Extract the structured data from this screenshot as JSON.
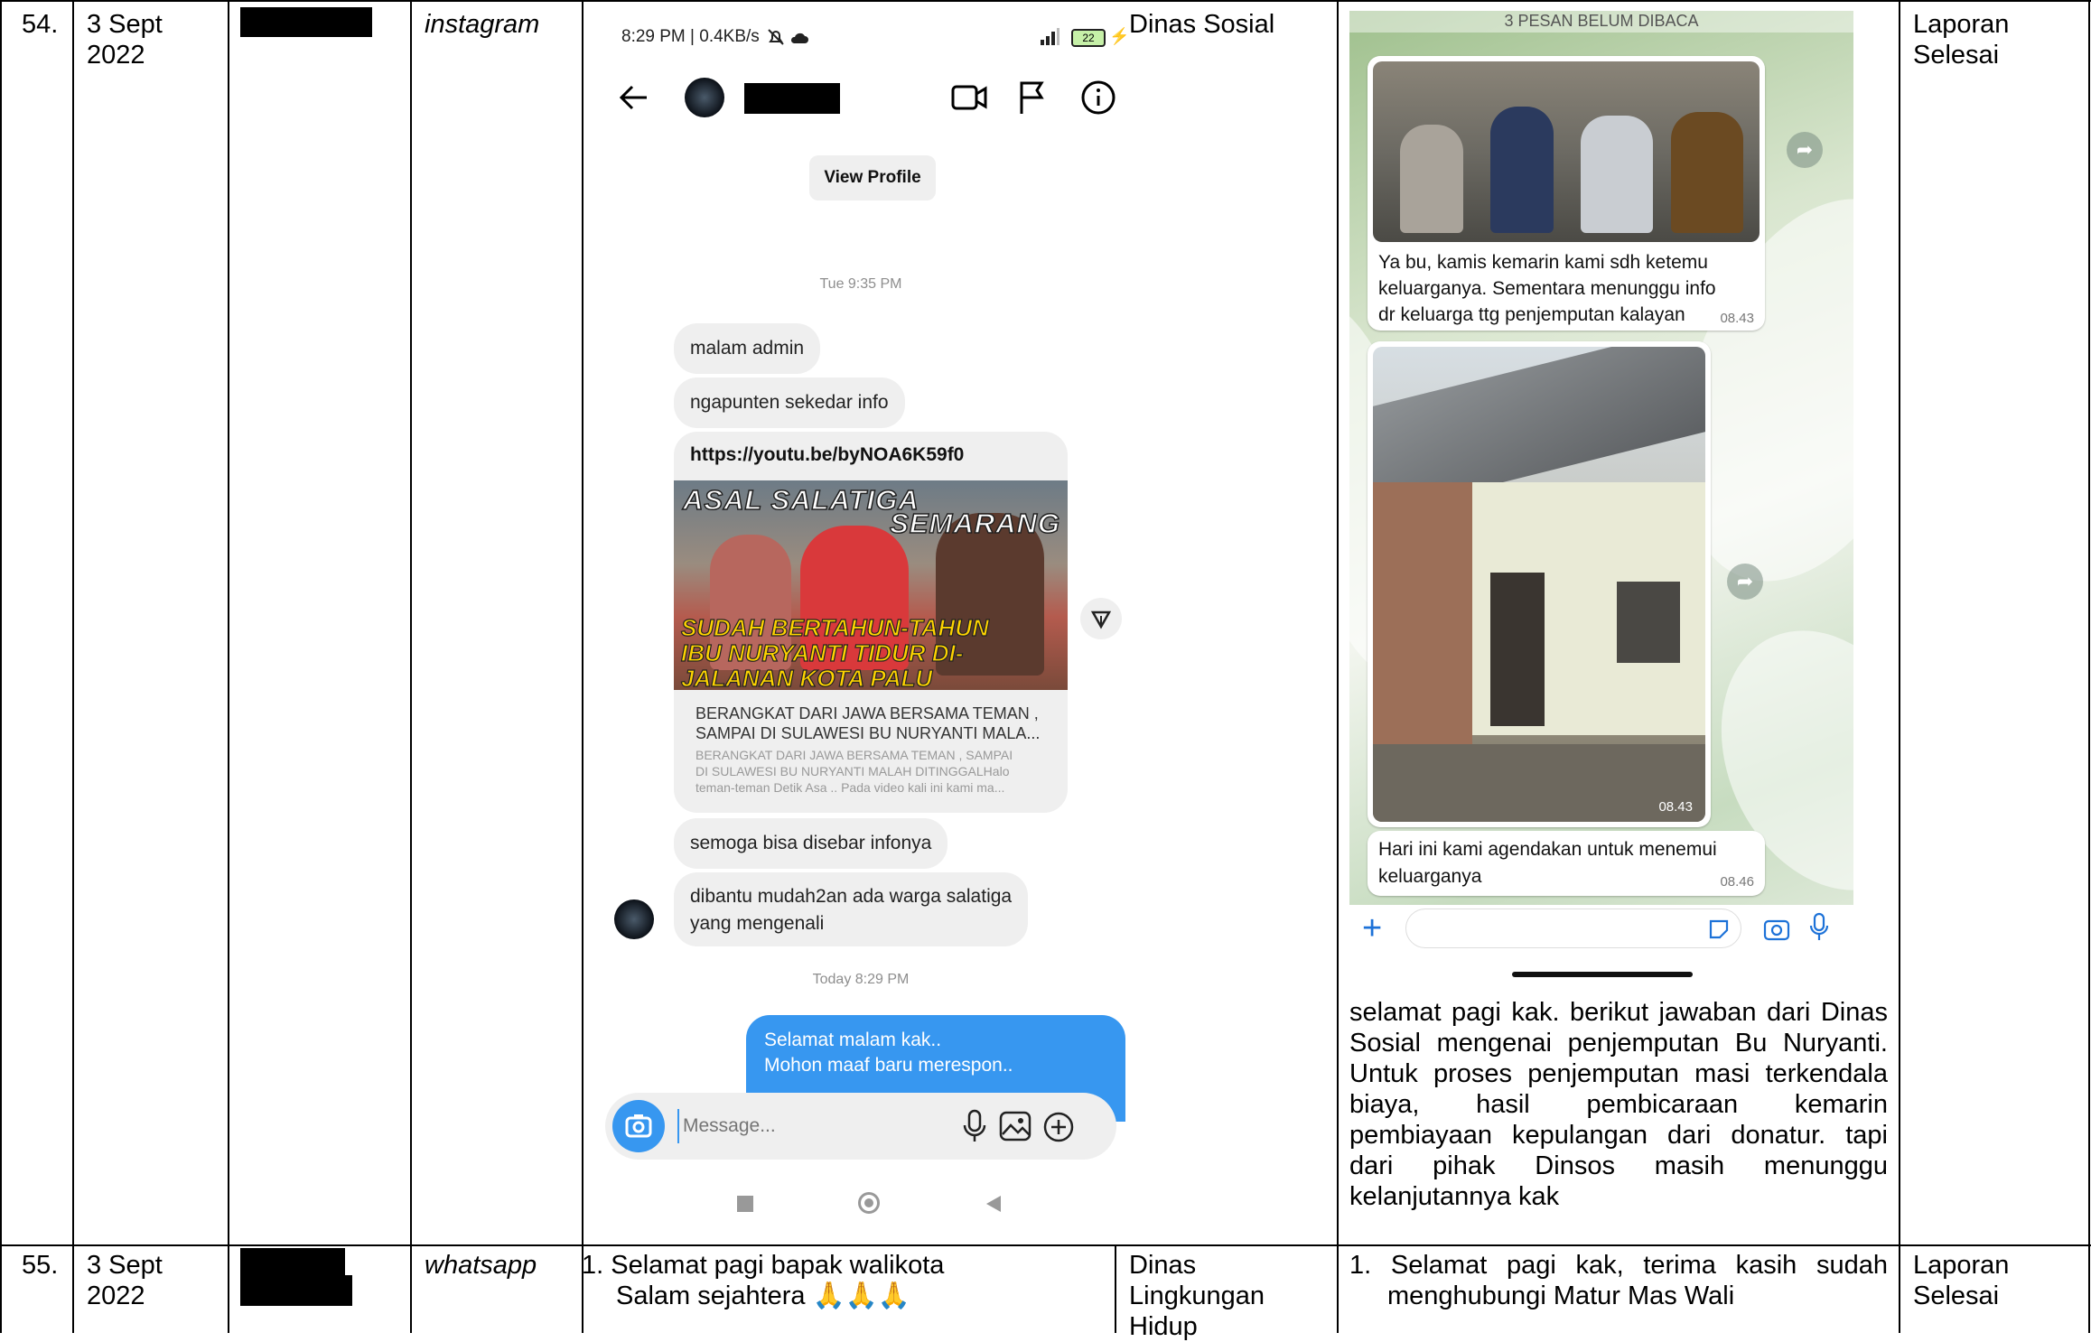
{
  "row54": {
    "number": "54.",
    "date": "3 Sept 2022",
    "channel": "instagram",
    "department": "Dinas Sosial",
    "response": "selamat pagi kak. berikut jawaban dari Dinas Sosial mengenai penjemputan Bu Nuryanti. Untuk proses penjemputan masi terkendala biaya, hasil pembicaraan kemarin pembiayaan kepulangan dari donatur. tapi dari pihak Dinsos masih menunggu kelanjutannya kak",
    "status": "Laporan Selesai"
  },
  "row55": {
    "number": "55.",
    "date": "3 Sept 2022",
    "channel": "whatsapp",
    "complaint_line1": "1. Selamat pagi bapak walikota",
    "complaint_line2": "Salam sejahtera 🙏🙏🙏",
    "department": "Dinas Lingkungan Hidup",
    "response_line1": "1. Selamat pagi kak, terima kasih sudah",
    "response_line2": "menghubungi Matur Mas Wali",
    "status": "Laporan Selesai"
  },
  "instagram": {
    "status_bar": "8:29 PM | 0.4KB/s",
    "battery": "22",
    "view_profile": "View Profile",
    "time1": "Tue 9:35 PM",
    "msg1": "malam admin",
    "msg2": "ngapunten sekedar info",
    "link": "https://youtu.be/byNOA6K59f0",
    "thumb_top1": "ASAL SALATIGA",
    "thumb_top2": "SEMARANG",
    "thumb_bottom1": "SUDAH BERTAHUN-TAHUN",
    "thumb_bottom2": "IBU NURYANTI TIDUR DI-",
    "thumb_bottom3": "JALANAN KOTA PALU",
    "link_title1": "BERANGKAT DARI JAWA BERSAMA TEMAN ,",
    "link_title2": "SAMPAI DI SULAWESI BU NURYANTI MALA...",
    "link_desc1": "BERANGKAT DARI JAWA BERSAMA TEMAN , SAMPAI",
    "link_desc2": "DI SULAWESI BU NURYANTI MALAH DITINGGALHalo",
    "link_desc3": "teman-teman Detik Asa .. Pada video kali ini kami ma...",
    "msg3": "semoga bisa disebar infonya",
    "msg4_line1": "dibantu mudah2an ada warga salatiga",
    "msg4_line2": "yang mengenali",
    "time2": "Today 8:29 PM",
    "reply_line1": "Selamat malam kak..",
    "reply_line2": "Mohon maaf baru merespon..",
    "message_placeholder": "Message..."
  },
  "whatsapp": {
    "unread_banner": "3 PESAN BELUM DIBACA",
    "msg1_line1": "Ya bu, kamis kemarin kami sdh ketemu",
    "msg1_line2": "keluarganya. Sementara menunggu info",
    "msg1_line3": "dr keluarga ttg penjemputan kalayan",
    "msg1_time": "08.43",
    "photo_time": "08.43",
    "msg2_line1": "Hari ini kami agendakan untuk menemui",
    "msg2_line2": "keluarganya",
    "msg2_time": "08.46"
  }
}
